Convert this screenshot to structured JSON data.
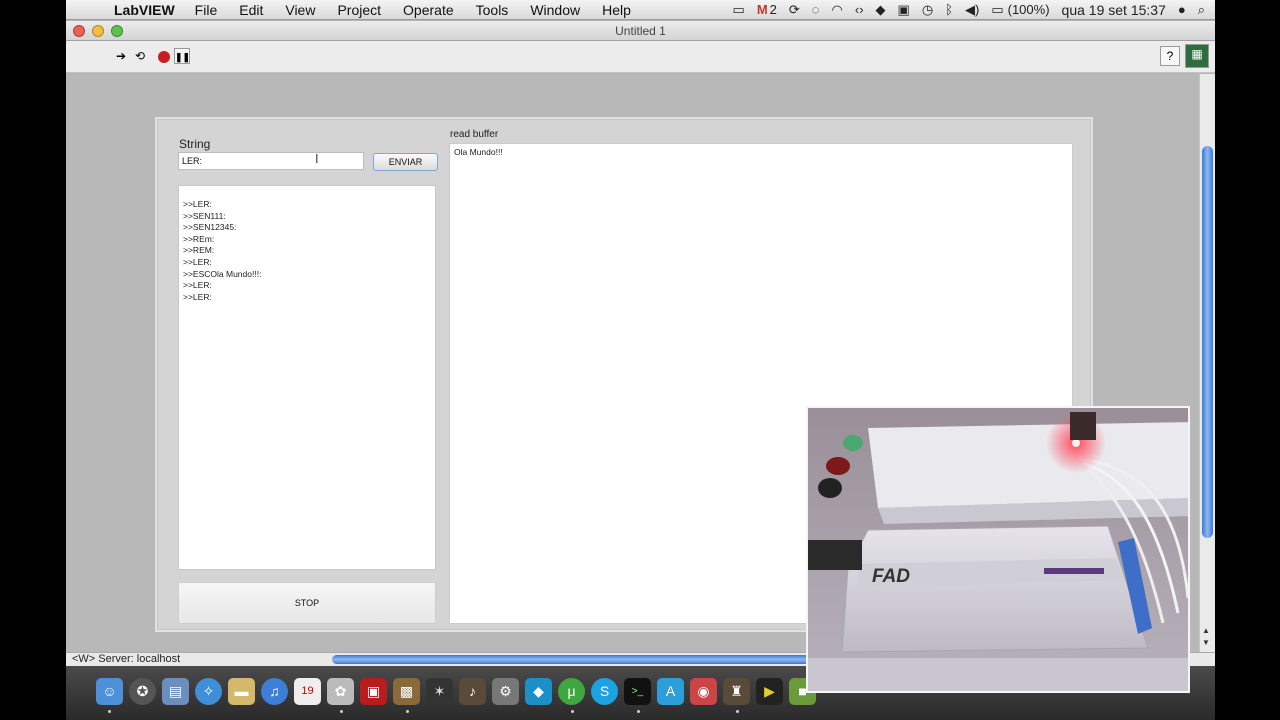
{
  "menubar": {
    "app_name": "LabVIEW",
    "items": [
      "File",
      "Edit",
      "View",
      "Project",
      "Operate",
      "Tools",
      "Window",
      "Help"
    ],
    "status": {
      "mail_count": "2",
      "battery": "(100%)",
      "datetime": "qua 19 set  15:37"
    }
  },
  "window": {
    "title": "Untitled 1"
  },
  "panel": {
    "string_label": "String",
    "string_value": "LER:",
    "enviar_label": "ENVIAR",
    "log_lines": [
      ">>LER:",
      ">>SEN111:",
      ">>SEN12345:",
      ">>REm:",
      ">>REM:",
      ">>LER:",
      ">>ESCOla Mundo!!!:",
      ">>LER:",
      ">>LER:"
    ],
    "stop_label": "STOP",
    "read_buffer_label": "read buffer",
    "read_buffer_value": "Ola Mundo!!!"
  },
  "statusbar": {
    "server": "<W> Server: localhost"
  },
  "webcam": {
    "device_label": "FAD"
  },
  "colors": {
    "scroll_accent": "#3a78d8",
    "led_red": "#ff2a3a"
  }
}
